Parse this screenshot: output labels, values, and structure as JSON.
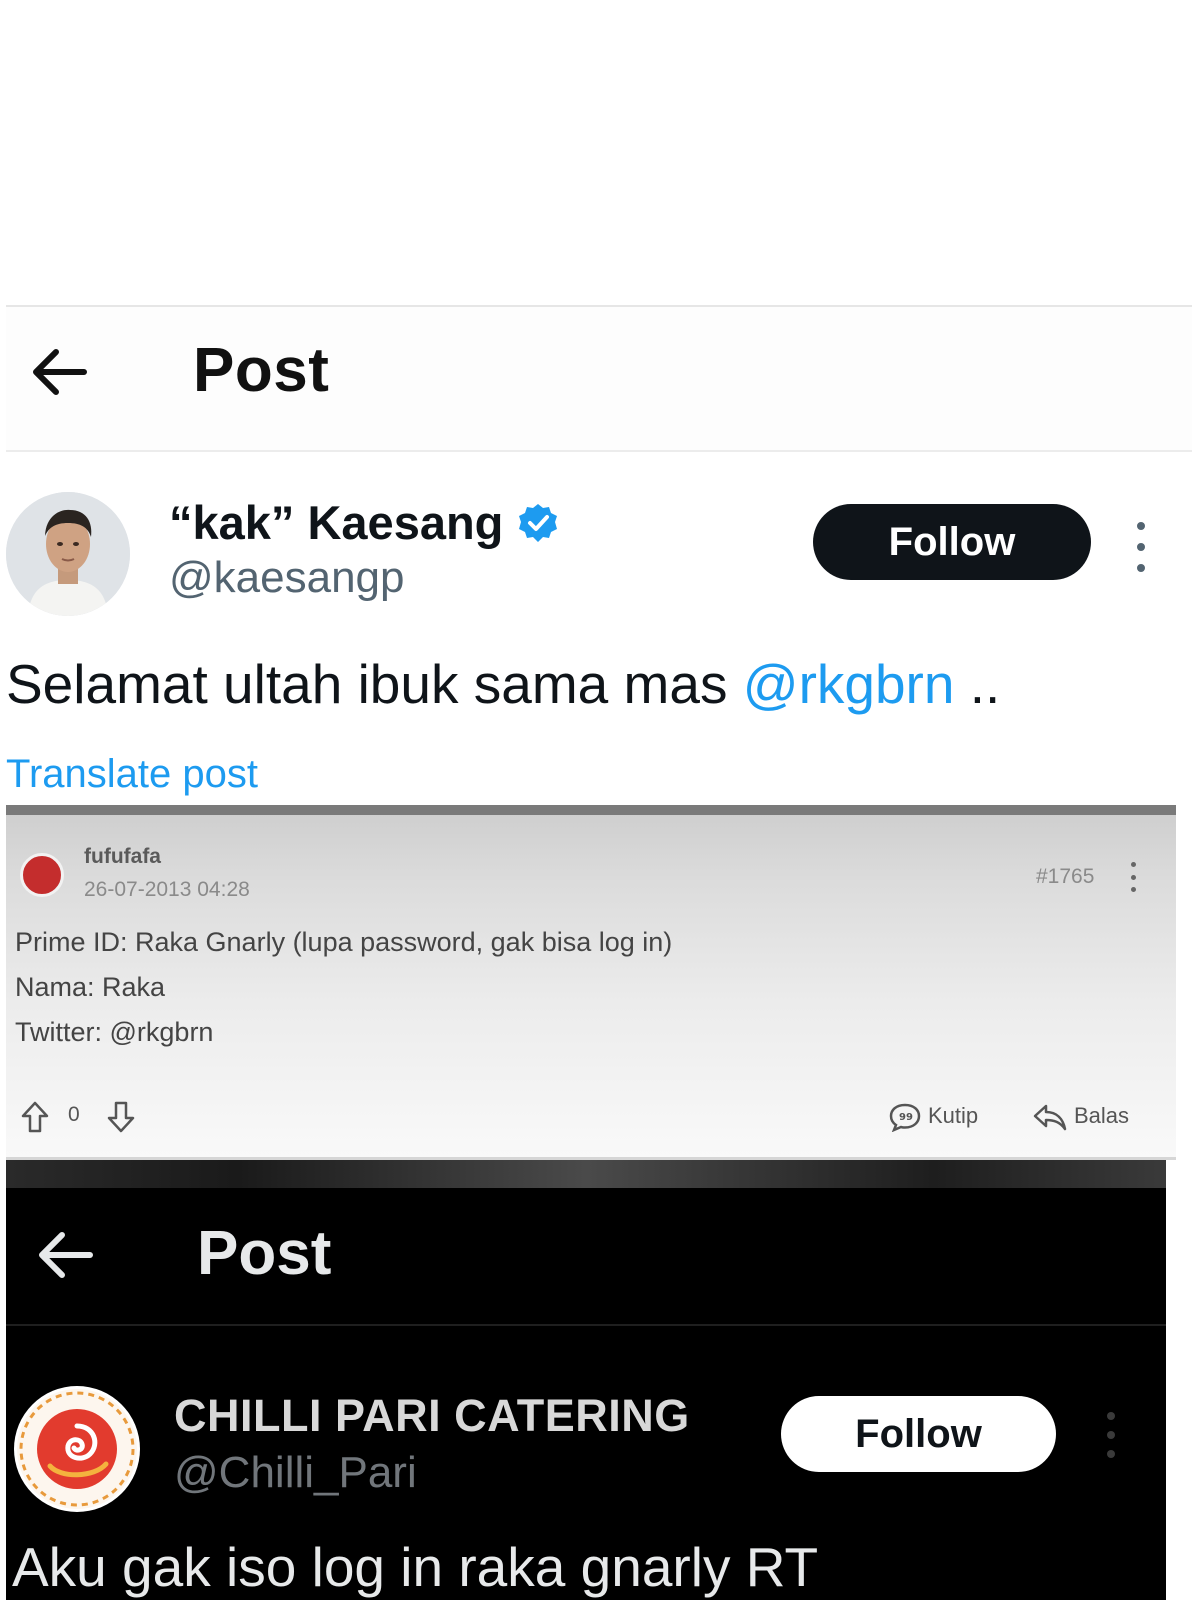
{
  "top_post": {
    "header": {
      "title": "Post"
    },
    "author": {
      "name": "“kak” Kaesang",
      "handle": "@kaesangp"
    },
    "follow_label": "Follow",
    "text_before": "Selamat ultah ibuk sama mas ",
    "mention": "@rkgbrn",
    "text_after": " ..",
    "translate_label": "Translate post"
  },
  "forum_post": {
    "username": "fufufafa",
    "date": "26-07-2013 04:28",
    "post_number": "#1765",
    "lines": [
      "Prime ID: Raka Gnarly (lupa password, gak bisa log in)",
      "Nama: Raka",
      "Twitter: @rkgbrn"
    ],
    "vote_count": "0",
    "quote_label": "Kutip",
    "reply_label": "Balas"
  },
  "bottom_post": {
    "header": {
      "title": "Post"
    },
    "author": {
      "name": "CHILLI PARI CATERING",
      "handle": "@Chilli_Pari"
    },
    "follow_label": "Follow",
    "text": "Aku gak iso log in raka gnarly RT"
  },
  "colors": {
    "link_blue": "#1d9bf0",
    "verified_blue": "#1d9bf0",
    "dark_bg": "#000000",
    "forum_avatar_red": "#c42d2d"
  }
}
